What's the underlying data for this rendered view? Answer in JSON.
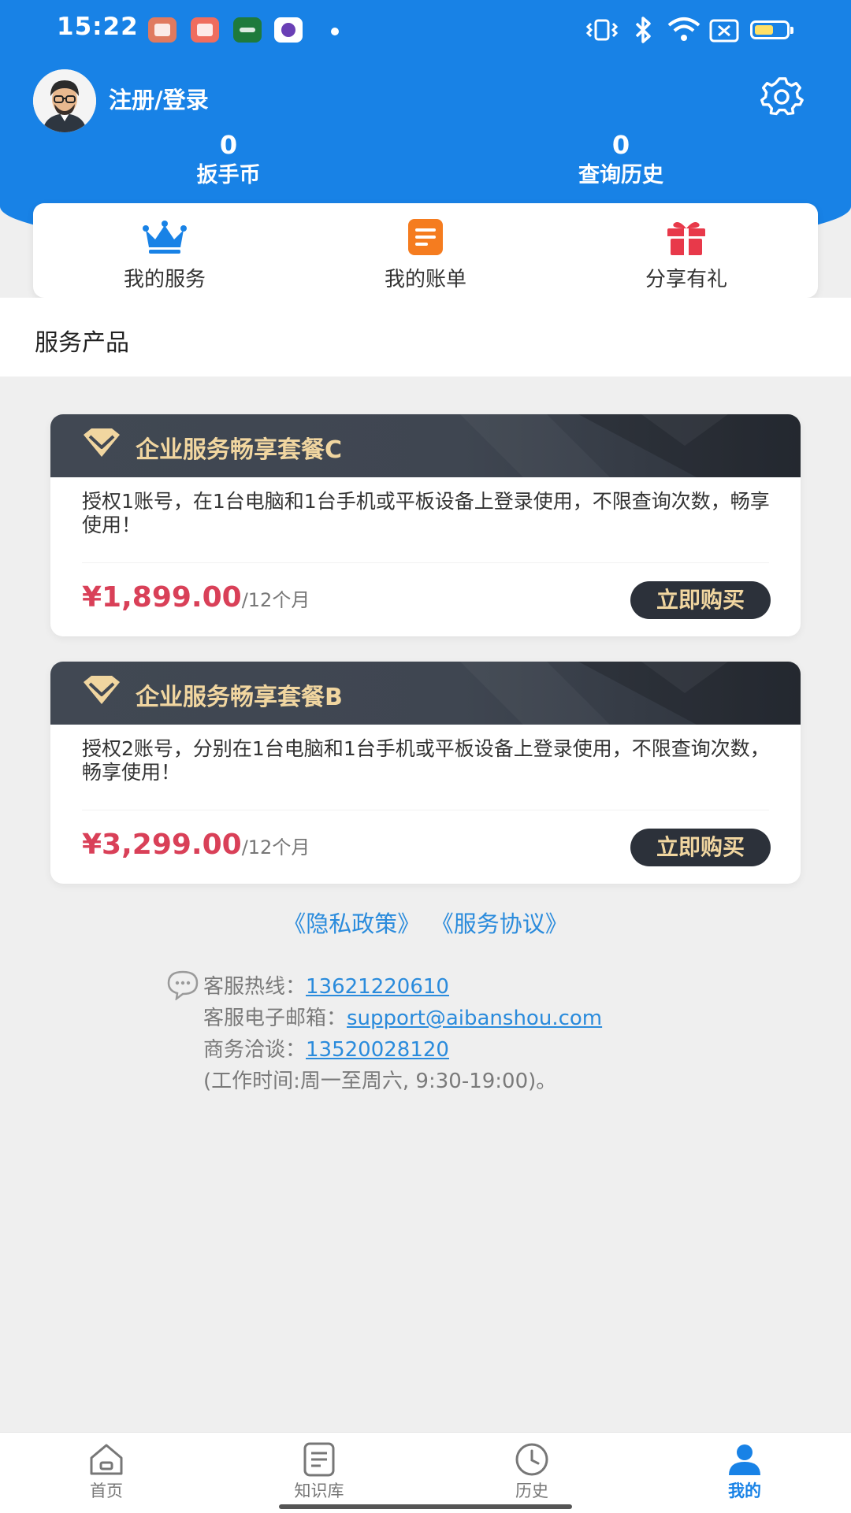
{
  "status_bar": {
    "time": "15:22",
    "notification_icons": [
      "mail-app-icon",
      "game-app-icon",
      "green-app-icon",
      "purple-app-icon"
    ],
    "system_icons": [
      "vibrate-icon",
      "bluetooth-icon",
      "wifi-icon",
      "sim-icon",
      "battery-icon"
    ],
    "battery_level": 0.6
  },
  "header": {
    "login_label": "注册/登录",
    "stats": [
      {
        "value": "0",
        "label": "扳手币"
      },
      {
        "value": "0",
        "label": "查询历史"
      }
    ]
  },
  "quick_actions": [
    {
      "label": "我的服务",
      "icon": "crown-icon"
    },
    {
      "label": "我的账单",
      "icon": "bill-icon"
    },
    {
      "label": "分享有礼",
      "icon": "gift-icon"
    }
  ],
  "section_title": "服务产品",
  "products": [
    {
      "title": "企业服务畅享套餐C",
      "description": "授权1账号，在1台电脑和1台手机或平板设备上登录使用，不限查询次数，畅享使用！",
      "price": "¥1,899.00",
      "period": "/12个月",
      "buy_label": "立即购买"
    },
    {
      "title": "企业服务畅享套餐B",
      "description": "授权2账号，分别在1台电脑和1台手机或平板设备上登录使用，不限查询次数，畅享使用！",
      "price": "¥3,299.00",
      "period": "/12个月",
      "buy_label": "立即购买"
    }
  ],
  "links": {
    "privacy": "《隐私政策》",
    "agreement": "《服务协议》"
  },
  "contact": {
    "hotline_label": "客服热线：",
    "hotline": "13621220610",
    "email_label": "客服电子邮箱：",
    "email": "support@aibanshou.com",
    "business_label": "商务洽谈：",
    "business_phone": "13520028120",
    "hours": "(工作时间:周一至周六, 9:30-19:00)。"
  },
  "tabbar": [
    {
      "label": "首页",
      "icon": "home-icon",
      "active": false
    },
    {
      "label": "知识库",
      "icon": "knowledge-icon",
      "active": false
    },
    {
      "label": "历史",
      "icon": "clock-icon",
      "active": false
    },
    {
      "label": "我的",
      "icon": "user-icon",
      "active": true
    }
  ],
  "colors": {
    "brand_blue": "#1882e6",
    "price_red": "#d94058",
    "gold": "#f1d6a0",
    "dark_card": "#3f4651",
    "link_blue": "#2a8bdc"
  }
}
